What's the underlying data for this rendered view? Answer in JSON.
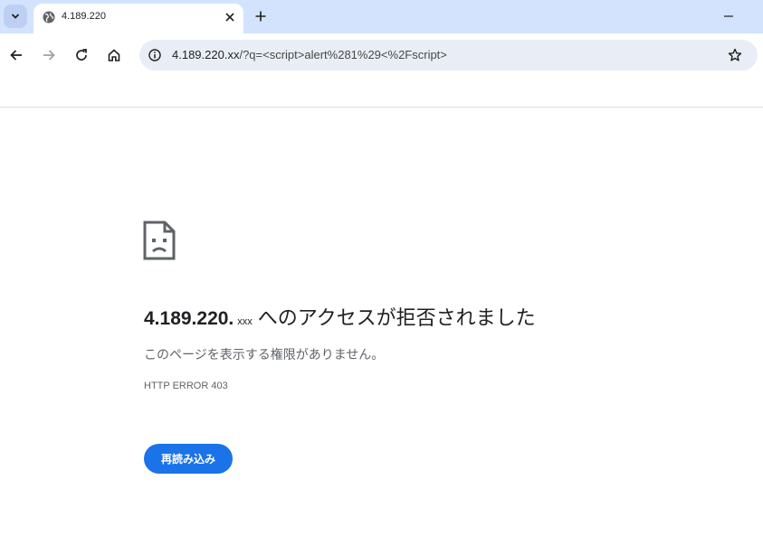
{
  "tab": {
    "title": "4.189.220",
    "favicon": "globe-icon",
    "close_icon": "close-icon"
  },
  "tabstrip": {
    "menu_icon": "chevron-down-icon",
    "new_tab_icon": "plus-icon",
    "minimize_icon": "minimize-icon"
  },
  "toolbar": {
    "back_icon": "back-arrow-icon",
    "forward_icon": "forward-arrow-icon",
    "reload_icon": "reload-icon",
    "home_icon": "home-icon",
    "site_info_icon": "site-info-icon",
    "url_host": "4.189.220.xx",
    "url_rest": "/?q=<script>alert%281%29<%2Fscript>",
    "bookmark_icon": "star-icon"
  },
  "error": {
    "icon": "sad-document-icon",
    "title_host": "4.189.220.",
    "title_host_suffix": "xxx",
    "title_message": "へのアクセスが拒否されました",
    "description": "このページを表示する権限がありません。",
    "code": "HTTP ERROR 403",
    "reload_label": "再読み込み"
  },
  "colors": {
    "tabstrip_bg": "#d3e3fd",
    "omnibox_bg": "#e9eef6",
    "accent": "#1a73e8"
  }
}
